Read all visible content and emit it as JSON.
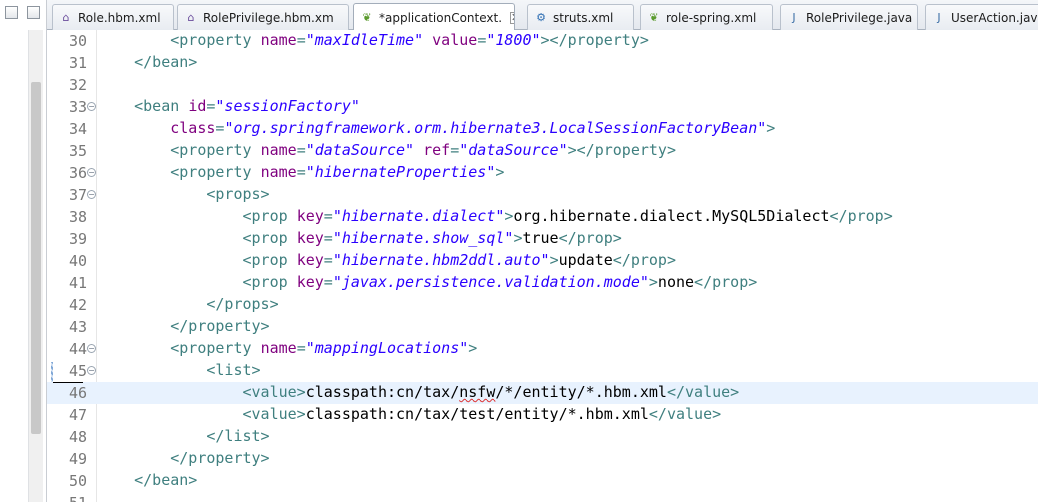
{
  "tabs": [
    {
      "label": "Role.hbm.xml",
      "icon": "xml-file-icon",
      "active": false
    },
    {
      "label": "RolePrivilege.hbm.xm",
      "icon": "xml-file-icon",
      "active": false
    },
    {
      "label": "*applicationContext.",
      "icon": "spring-file-icon",
      "active": true,
      "close": "✕"
    },
    {
      "label": "struts.xml",
      "icon": "struts-gear-icon",
      "active": false
    },
    {
      "label": "role-spring.xml",
      "icon": "spring-file-icon",
      "active": false
    },
    {
      "label": "RolePrivilege.java",
      "icon": "java-file-icon",
      "active": false
    },
    {
      "label": "UserAction.java",
      "icon": "java-file-icon",
      "active": false
    }
  ],
  "editor": {
    "current_line": 46,
    "colors": {
      "tag": "#3f7f7f",
      "attr": "#7f007f",
      "value": "#2a00ff",
      "current_line_bg": "#e8f2fe"
    },
    "lines": [
      {
        "n": "30",
        "fold": false,
        "tokens": [
          [
            "t",
            "        <property "
          ],
          [
            "a",
            "name"
          ],
          [
            "t",
            "="
          ],
          [
            "v",
            "\"maxIdleTime\""
          ],
          [
            "t",
            " "
          ],
          [
            "a",
            "value"
          ],
          [
            "t",
            "="
          ],
          [
            "v",
            "\"1800\""
          ],
          [
            "t",
            "></property>"
          ]
        ]
      },
      {
        "n": "31",
        "fold": false,
        "tokens": [
          [
            "t",
            "    </bean>"
          ]
        ]
      },
      {
        "n": "32",
        "fold": false,
        "tokens": []
      },
      {
        "n": "33",
        "fold": true,
        "tokens": [
          [
            "t",
            "    <bean "
          ],
          [
            "a",
            "id"
          ],
          [
            "t",
            "="
          ],
          [
            "v",
            "\"sessionFactory\""
          ]
        ]
      },
      {
        "n": "34",
        "fold": false,
        "tokens": [
          [
            "a",
            "        class"
          ],
          [
            "t",
            "="
          ],
          [
            "v",
            "\"org.springframework.orm.hibernate3.LocalSessionFactoryBean\""
          ],
          [
            "t",
            ">"
          ]
        ]
      },
      {
        "n": "35",
        "fold": false,
        "tokens": [
          [
            "t",
            "        <property "
          ],
          [
            "a",
            "name"
          ],
          [
            "t",
            "="
          ],
          [
            "v",
            "\"dataSource\""
          ],
          [
            "t",
            " "
          ],
          [
            "a",
            "ref"
          ],
          [
            "t",
            "="
          ],
          [
            "v",
            "\"dataSource\""
          ],
          [
            "t",
            "></property>"
          ]
        ]
      },
      {
        "n": "36",
        "fold": true,
        "tokens": [
          [
            "t",
            "        <property "
          ],
          [
            "a",
            "name"
          ],
          [
            "t",
            "="
          ],
          [
            "v",
            "\"hibernateProperties\""
          ],
          [
            "t",
            ">"
          ]
        ]
      },
      {
        "n": "37",
        "fold": true,
        "tokens": [
          [
            "t",
            "            <props>"
          ]
        ]
      },
      {
        "n": "38",
        "fold": false,
        "tokens": [
          [
            "t",
            "                <prop "
          ],
          [
            "a",
            "key"
          ],
          [
            "t",
            "="
          ],
          [
            "v",
            "\"hibernate.dialect\""
          ],
          [
            "t",
            ">"
          ],
          [
            "x",
            "org.hibernate.dialect.MySQL5Dialect"
          ],
          [
            "t",
            "</prop>"
          ]
        ]
      },
      {
        "n": "39",
        "fold": false,
        "tokens": [
          [
            "t",
            "                <prop "
          ],
          [
            "a",
            "key"
          ],
          [
            "t",
            "="
          ],
          [
            "v",
            "\"hibernate.show_sql\""
          ],
          [
            "t",
            ">"
          ],
          [
            "x",
            "true"
          ],
          [
            "t",
            "</prop>"
          ]
        ]
      },
      {
        "n": "40",
        "fold": false,
        "tokens": [
          [
            "t",
            "                <prop "
          ],
          [
            "a",
            "key"
          ],
          [
            "t",
            "="
          ],
          [
            "v",
            "\"hibernate.hbm2ddl.auto\""
          ],
          [
            "t",
            ">"
          ],
          [
            "x",
            "update"
          ],
          [
            "t",
            "</prop>"
          ]
        ]
      },
      {
        "n": "41",
        "fold": false,
        "tokens": [
          [
            "t",
            "                <prop "
          ],
          [
            "a",
            "key"
          ],
          [
            "t",
            "="
          ],
          [
            "v",
            "\"javax.persistence.validation.mode\""
          ],
          [
            "t",
            ">"
          ],
          [
            "x",
            "none"
          ],
          [
            "t",
            "</prop>"
          ]
        ]
      },
      {
        "n": "42",
        "fold": false,
        "tokens": [
          [
            "t",
            "            </props>"
          ]
        ]
      },
      {
        "n": "43",
        "fold": false,
        "tokens": [
          [
            "t",
            "        </property>"
          ]
        ]
      },
      {
        "n": "44",
        "fold": true,
        "tokens": [
          [
            "t",
            "        <property "
          ],
          [
            "a",
            "name"
          ],
          [
            "t",
            "="
          ],
          [
            "v",
            "\"mappingLocations\""
          ],
          [
            "t",
            ">"
          ]
        ]
      },
      {
        "n": "45",
        "fold": true,
        "tokens": [
          [
            "t",
            "            <list>"
          ]
        ]
      },
      {
        "n": "46",
        "fold": false,
        "tokens": [
          [
            "t",
            "                <value>"
          ],
          [
            "x",
            "classpath:cn/tax/"
          ],
          [
            "s",
            "nsfw"
          ],
          [
            "x",
            "/*/entity/*.hbm.xml"
          ],
          [
            "t",
            "</value>"
          ]
        ]
      },
      {
        "n": "47",
        "fold": false,
        "tokens": [
          [
            "t",
            "                <value>"
          ],
          [
            "x",
            "classpath:cn/tax/test/entity/*.hbm.xml"
          ],
          [
            "t",
            "</value>"
          ]
        ]
      },
      {
        "n": "48",
        "fold": false,
        "tokens": [
          [
            "t",
            "            </list>"
          ]
        ]
      },
      {
        "n": "49",
        "fold": false,
        "tokens": [
          [
            "t",
            "        </property>"
          ]
        ]
      },
      {
        "n": "50",
        "fold": false,
        "tokens": [
          [
            "t",
            "    </bean>"
          ]
        ]
      },
      {
        "n": "51",
        "fold": false,
        "tokens": []
      }
    ]
  }
}
